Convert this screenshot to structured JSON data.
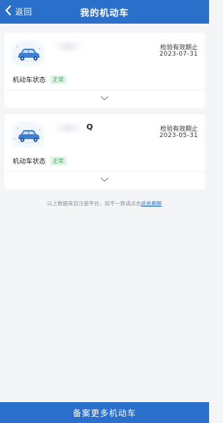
{
  "header": {
    "back_label": "返回",
    "title": "我的机动车"
  },
  "vehicles": [
    {
      "plate_visible": "",
      "expiry_label": "检验有效期止",
      "expiry_date": "2023-07-31",
      "status_label": "机动车状态",
      "status_value": "正常"
    },
    {
      "plate_visible": "Q",
      "expiry_label": "检验有效期止",
      "expiry_date": "2023-05-31",
      "status_label": "机动车状态",
      "status_value": "正常"
    }
  ],
  "footnote": {
    "text": "以上数据来自注册平台，如不一致请点击",
    "link": "此处刷新"
  },
  "bottom_button": "备案更多机动车",
  "colors": {
    "primary": "#2a6fc9",
    "status_green": "#2fae5b",
    "status_bg": "#e3f5e9",
    "background": "#f3f5f7"
  },
  "icons": {
    "back": "chevron-left-icon",
    "car": "car-icon",
    "expand": "chevron-down-icon"
  }
}
